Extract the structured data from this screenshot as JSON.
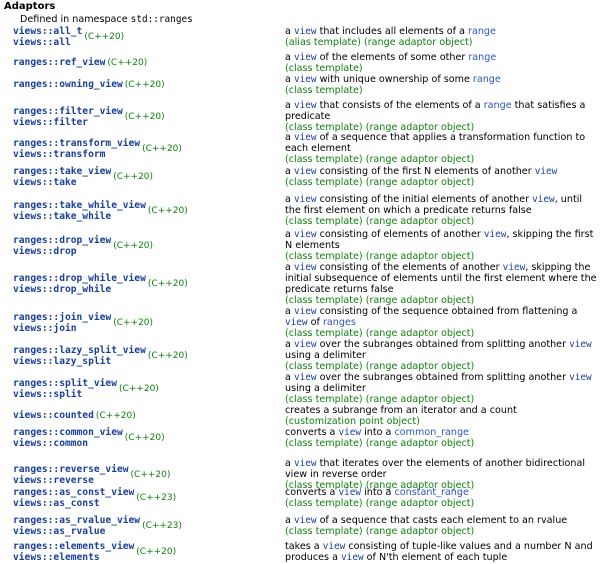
{
  "heading": "Adaptors",
  "namespace_prefix": "Defined in namespace",
  "namespace_name": "std::ranges",
  "rows": [
    {
      "names": [
        "views::all_t",
        "views::all"
      ],
      "ver": "(C++20)",
      "desc": [
        {
          "t": "a "
        },
        {
          "c": "view"
        },
        {
          "t": " that includes all elements of a "
        },
        {
          "l": "range"
        }
      ],
      "kind": "(alias template) (range adaptor object)"
    },
    {
      "names": [
        "ranges::ref_view"
      ],
      "ver": "(C++20)",
      "desc": [
        {
          "t": "a "
        },
        {
          "c": "view"
        },
        {
          "t": " of the elements of some other "
        },
        {
          "l": "range"
        }
      ],
      "kind": "(class template)"
    },
    {
      "names": [
        "ranges::owning_view"
      ],
      "ver": "(C++20)",
      "desc": [
        {
          "t": "a "
        },
        {
          "c": "view"
        },
        {
          "t": " with unique ownership of some "
        },
        {
          "l": "range"
        }
      ],
      "kind": "(class template)"
    },
    {
      "names": [
        "ranges::filter_view",
        "views::filter"
      ],
      "ver": "(C++20)",
      "desc": [
        {
          "t": "a "
        },
        {
          "c": "view"
        },
        {
          "t": " that consists of the elements of a "
        },
        {
          "l": "range"
        },
        {
          "t": " that satisfies a predicate"
        }
      ],
      "kind": "(class template) (range adaptor object)"
    },
    {
      "names": [
        "ranges::transform_view",
        "views::transform"
      ],
      "ver": "(C++20)",
      "desc": [
        {
          "t": "a "
        },
        {
          "c": "view"
        },
        {
          "t": " of a sequence that applies a transformation function to each element"
        }
      ],
      "kind": "(class template) (range adaptor object)"
    },
    {
      "names": [
        "ranges::take_view",
        "views::take"
      ],
      "ver": "(C++20)",
      "desc": [
        {
          "t": "a "
        },
        {
          "c": "view"
        },
        {
          "t": " consisting of the first N elements of another "
        },
        {
          "c": "view"
        }
      ],
      "kind": "(class template) (range adaptor object)"
    },
    {
      "names": [
        "ranges::take_while_view",
        "views::take_while"
      ],
      "ver": "(C++20)",
      "desc": [
        {
          "t": "a "
        },
        {
          "c": "view"
        },
        {
          "t": " consisting of the initial elements of another "
        },
        {
          "c": "view"
        },
        {
          "t": ", until the first element on which a predicate returns false"
        }
      ],
      "kind": "(class template) (range adaptor object)"
    },
    {
      "names": [
        "ranges::drop_view",
        "views::drop"
      ],
      "ver": "(C++20)",
      "desc": [
        {
          "t": "a "
        },
        {
          "c": "view"
        },
        {
          "t": " consisting of elements of another "
        },
        {
          "c": "view"
        },
        {
          "t": ", skipping the first N elements"
        }
      ],
      "kind": "(class template) (range adaptor object)"
    },
    {
      "names": [
        "ranges::drop_while_view",
        "views::drop_while"
      ],
      "ver": "(C++20)",
      "desc": [
        {
          "t": "a "
        },
        {
          "c": "view"
        },
        {
          "t": " consisting of the elements of another "
        },
        {
          "c": "view"
        },
        {
          "t": ", skipping the initial subsequence of elements until the first element where the predicate returns false"
        }
      ],
      "kind": "(class template) (range adaptor object)"
    },
    {
      "names": [
        "ranges::join_view",
        "views::join"
      ],
      "ver": "(C++20)",
      "desc": [
        {
          "t": "a "
        },
        {
          "c": "view"
        },
        {
          "t": " consisting of the sequence obtained from flattening a "
        },
        {
          "c": "view"
        },
        {
          "t": " of "
        },
        {
          "l": "ranges"
        }
      ],
      "kind": "(class template) (range adaptor object)"
    },
    {
      "names": [
        "ranges::lazy_split_view",
        "views::lazy_split"
      ],
      "ver": "(C++20)",
      "desc": [
        {
          "t": "a "
        },
        {
          "c": "view"
        },
        {
          "t": " over the subranges obtained from splitting another "
        },
        {
          "c": "view"
        },
        {
          "t": " using a delimiter"
        }
      ],
      "kind": "(class template) (range adaptor object)"
    },
    {
      "names": [
        "ranges::split_view",
        "views::split"
      ],
      "ver": "(C++20)",
      "desc": [
        {
          "t": "a "
        },
        {
          "c": "view"
        },
        {
          "t": " over the subranges obtained from splitting another "
        },
        {
          "c": "view"
        },
        {
          "t": " using a delimiter"
        }
      ],
      "kind": "(class template) (range adaptor object)"
    },
    {
      "names": [
        "views::counted"
      ],
      "ver": "(C++20)",
      "desc": [
        {
          "t": "creates a subrange from an iterator and a count"
        }
      ],
      "kind": "(customization point object)"
    },
    {
      "names": [
        "ranges::common_view",
        "views::common"
      ],
      "ver": "(C++20)",
      "desc": [
        {
          "t": "converts a "
        },
        {
          "c": "view"
        },
        {
          "t": " into a "
        },
        {
          "l": "common_range"
        }
      ],
      "kind": "(class template) (range adaptor object)"
    },
    {
      "names": [
        "ranges::reverse_view",
        "views::reverse"
      ],
      "ver": "(C++20)",
      "desc": [
        {
          "t": "a "
        },
        {
          "c": "view"
        },
        {
          "t": " that iterates over the elements of another bidirectional view in reverse order"
        }
      ],
      "kind": "(class template) (range adaptor object)"
    },
    {
      "names": [
        "ranges::as_const_view",
        "views::as_const"
      ],
      "ver": "(C++23)",
      "desc": [
        {
          "t": "converts a "
        },
        {
          "c": "view"
        },
        {
          "t": " into a "
        },
        {
          "l": "constant_range"
        }
      ],
      "kind": "(class template) (range adaptor object)"
    },
    {
      "names": [
        "ranges::as_rvalue_view",
        "views::as_rvalue"
      ],
      "ver": "(C++23)",
      "desc": [
        {
          "t": "a "
        },
        {
          "c": "view"
        },
        {
          "t": " of a sequence that casts each element to an rvalue"
        }
      ],
      "kind": "(class template) (range adaptor object)"
    },
    {
      "names": [
        "ranges::elements_view",
        "views::elements"
      ],
      "ver": "(C++20)",
      "desc": [
        {
          "t": "takes a "
        },
        {
          "c": "view"
        },
        {
          "t": " consisting of tuple-like values and a number N and produces a "
        },
        {
          "c": "view"
        },
        {
          "t": " of N'th element of each tuple"
        }
      ],
      "kind": ""
    }
  ]
}
